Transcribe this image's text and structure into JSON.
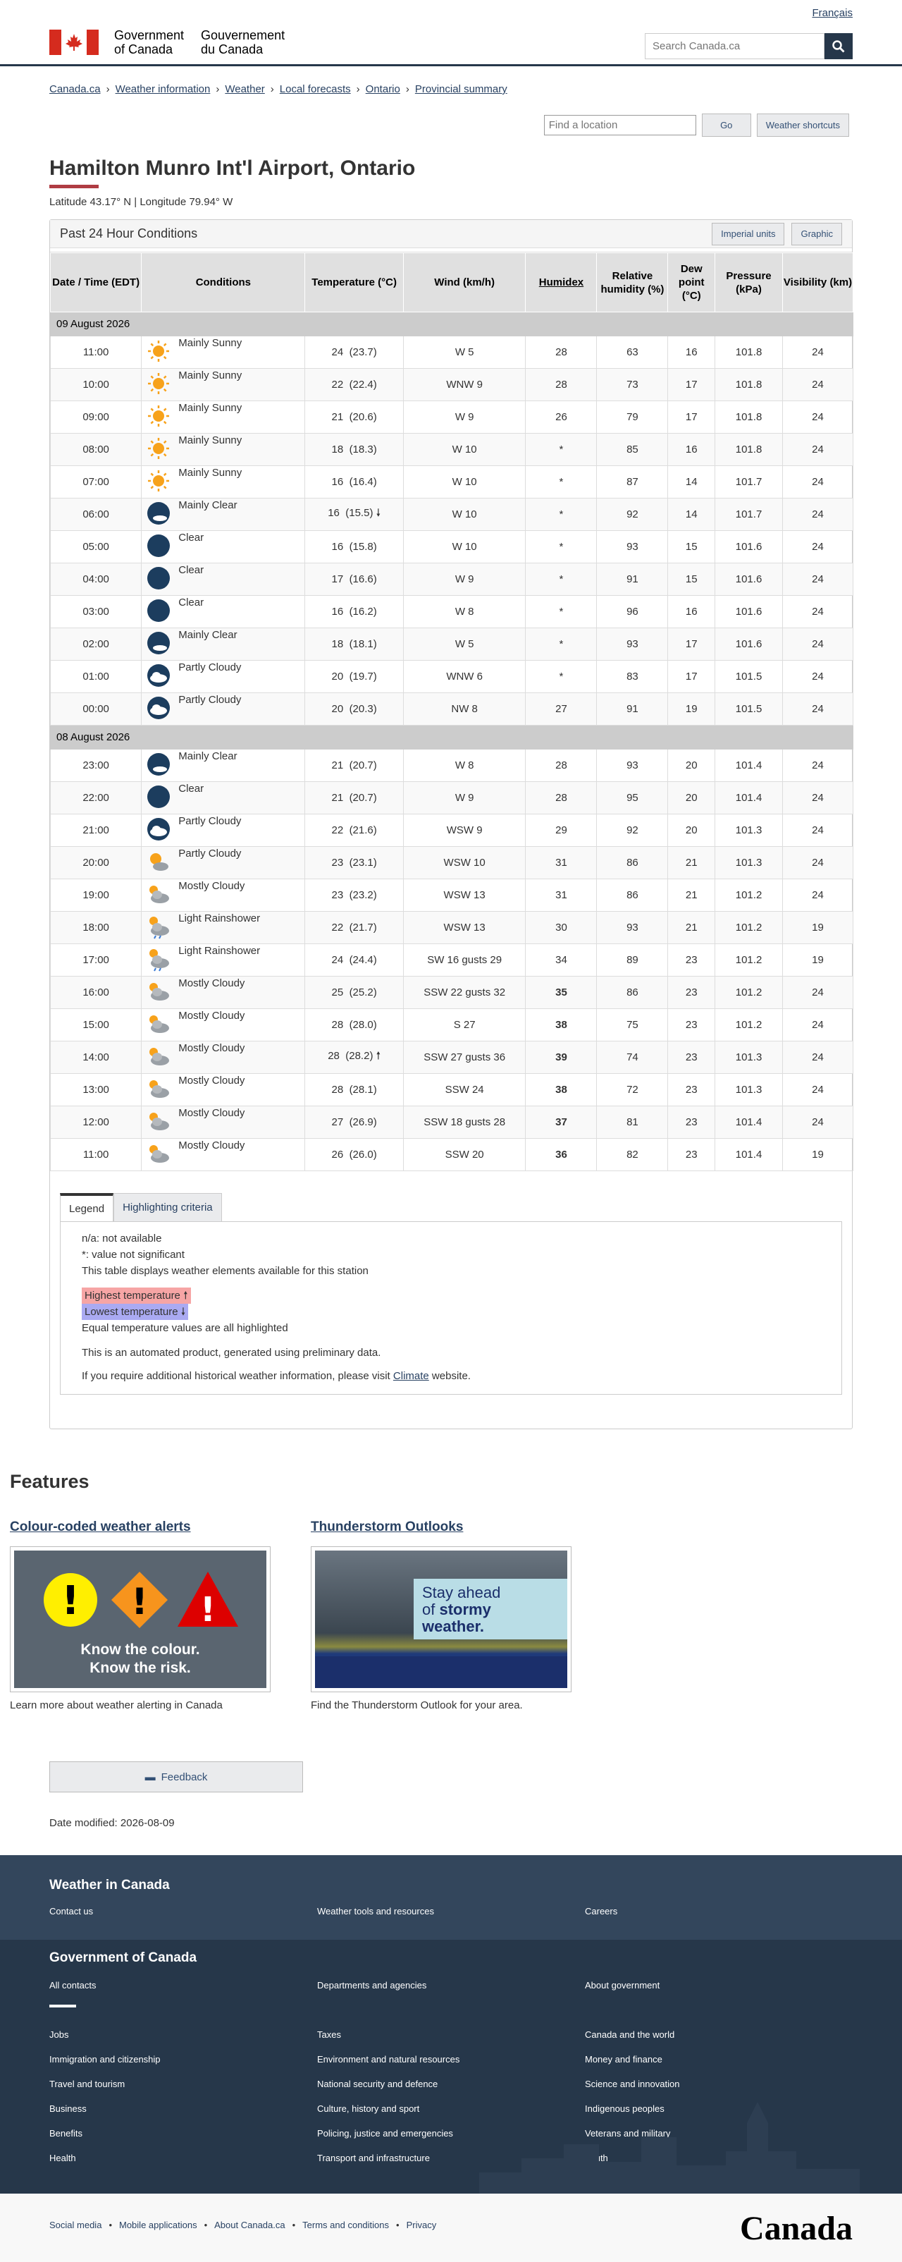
{
  "header": {
    "lang": "Français",
    "gov_en1": "Government",
    "gov_en2": "of Canada",
    "gov_fr1": "Gouvernement",
    "gov_fr2": "du Canada",
    "search_placeholder": "Search Canada.ca"
  },
  "breadcrumbs": [
    "Canada.ca",
    "Weather information",
    "Weather",
    "Local forecasts",
    "Ontario",
    "Provincial summary"
  ],
  "tools": {
    "find_placeholder": "Find a location",
    "go": "Go",
    "shortcuts": "Weather shortcuts"
  },
  "page": {
    "title": "Hamilton Munro Int'l Airport, Ontario",
    "coords": "Latitude 43.17° N | Longitude 79.94° W"
  },
  "panel": {
    "title": "Past 24 Hour Conditions",
    "imperial": "Imperial units",
    "graphic": "Graphic"
  },
  "table": {
    "headers": [
      "Date / Time (EDT)",
      "Conditions",
      "Temperature (°C)",
      "Wind (km/h)",
      "Humidex",
      "Relative humidity (%)",
      "Dew point (°C)",
      "Pressure (kPa)",
      "Visibility (km)"
    ],
    "days": [
      {
        "date": "09 August 2026",
        "rows": [
          [
            "11:00",
            "sun",
            "Mainly Sunny",
            "24",
            "(23.7)",
            "W 5",
            "28",
            "63",
            "16",
            "101.8",
            "24",
            ""
          ],
          [
            "10:00",
            "sun",
            "Mainly Sunny",
            "22",
            "(22.4)",
            "WNW 9",
            "28",
            "73",
            "17",
            "101.8",
            "24",
            ""
          ],
          [
            "09:00",
            "sun",
            "Mainly Sunny",
            "21",
            "(20.6)",
            "W 9",
            "26",
            "79",
            "17",
            "101.8",
            "24",
            ""
          ],
          [
            "08:00",
            "sun",
            "Mainly Sunny",
            "18",
            "(18.3)",
            "W 10",
            "*",
            "85",
            "16",
            "101.8",
            "24",
            ""
          ],
          [
            "07:00",
            "sun",
            "Mainly Sunny",
            "16",
            "(16.4)",
            "W 10",
            "*",
            "87",
            "14",
            "101.7",
            "24",
            ""
          ],
          [
            "06:00",
            "mclear",
            "Mainly Clear",
            "16",
            "(15.5)",
            "W 10",
            "*",
            "92",
            "14",
            "101.7",
            "24",
            "lo"
          ],
          [
            "05:00",
            "moon",
            "Clear",
            "16",
            "(15.8)",
            "W 10",
            "*",
            "93",
            "15",
            "101.6",
            "24",
            ""
          ],
          [
            "04:00",
            "moon",
            "Clear",
            "17",
            "(16.6)",
            "W 9",
            "*",
            "91",
            "15",
            "101.6",
            "24",
            ""
          ],
          [
            "03:00",
            "moon",
            "Clear",
            "16",
            "(16.2)",
            "W 8",
            "*",
            "96",
            "16",
            "101.6",
            "24",
            ""
          ],
          [
            "02:00",
            "mclear",
            "Mainly Clear",
            "18",
            "(18.1)",
            "W 5",
            "*",
            "93",
            "17",
            "101.6",
            "24",
            ""
          ],
          [
            "01:00",
            "pcloudn",
            "Partly Cloudy",
            "20",
            "(19.7)",
            "WNW 6",
            "*",
            "83",
            "17",
            "101.5",
            "24",
            ""
          ],
          [
            "00:00",
            "pcloudn",
            "Partly Cloudy",
            "20",
            "(20.3)",
            "NW 8",
            "27",
            "91",
            "19",
            "101.5",
            "24",
            ""
          ]
        ]
      },
      {
        "date": "08 August 2026",
        "rows": [
          [
            "23:00",
            "mclear",
            "Mainly Clear",
            "21",
            "(20.7)",
            "W 8",
            "28",
            "93",
            "20",
            "101.4",
            "24",
            ""
          ],
          [
            "22:00",
            "moon",
            "Clear",
            "21",
            "(20.7)",
            "W 9",
            "28",
            "95",
            "20",
            "101.4",
            "24",
            ""
          ],
          [
            "21:00",
            "pcloudn",
            "Partly Cloudy",
            "22",
            "(21.6)",
            "WSW 9",
            "29",
            "92",
            "20",
            "101.3",
            "24",
            ""
          ],
          [
            "20:00",
            "pcloud",
            "Partly Cloudy",
            "23",
            "(23.1)",
            "WSW 10",
            "31",
            "86",
            "21",
            "101.3",
            "24",
            ""
          ],
          [
            "19:00",
            "mcloud",
            "Mostly Cloudy",
            "23",
            "(23.2)",
            "WSW 13",
            "31",
            "86",
            "21",
            "101.2",
            "24",
            ""
          ],
          [
            "18:00",
            "rain",
            "Light Rainshower",
            "22",
            "(21.7)",
            "WSW 13",
            "30",
            "93",
            "21",
            "101.2",
            "19",
            ""
          ],
          [
            "17:00",
            "rain",
            "Light Rainshower",
            "24",
            "(24.4)",
            "SW 16 gusts 29",
            "34",
            "89",
            "23",
            "101.2",
            "19",
            ""
          ],
          [
            "16:00",
            "mcloud",
            "Mostly Cloudy",
            "25",
            "(25.2)",
            "SSW 22 gusts 32",
            "35",
            "86",
            "23",
            "101.2",
            "24",
            "",
            true
          ],
          [
            "15:00",
            "mcloud",
            "Mostly Cloudy",
            "28",
            "(28.0)",
            "S 27",
            "38",
            "75",
            "23",
            "101.2",
            "24",
            "",
            true
          ],
          [
            "14:00",
            "mcloud",
            "Mostly Cloudy",
            "28",
            "(28.2)",
            "SSW 27 gusts 36",
            "39",
            "74",
            "23",
            "101.3",
            "24",
            "hi",
            true
          ],
          [
            "13:00",
            "mcloud",
            "Mostly Cloudy",
            "28",
            "(28.1)",
            "SSW 24",
            "38",
            "72",
            "23",
            "101.3",
            "24",
            "",
            true
          ],
          [
            "12:00",
            "mcloud",
            "Mostly Cloudy",
            "27",
            "(26.9)",
            "SSW 18 gusts 28",
            "37",
            "81",
            "23",
            "101.4",
            "24",
            "",
            true
          ],
          [
            "11:00",
            "mcloud",
            "Mostly Cloudy",
            "26",
            "(26.0)",
            "SSW 20",
            "36",
            "82",
            "23",
            "101.4",
            "19",
            "",
            true
          ]
        ]
      }
    ]
  },
  "legend": {
    "tab1": "Legend",
    "tab2": "Highlighting criteria",
    "l1": "n/a: not available",
    "l2": "*: value not significant",
    "l3": "This table displays weather elements available for this station",
    "hi": "Highest temperature",
    "lo": "Lowest temperature",
    "eq": "Equal temperature values are all highlighted",
    "auto": "This is an automated product, generated using preliminary data.",
    "hist1": "If you require additional historical weather information, please visit ",
    "hist_link": "Climate",
    "hist2": " website."
  },
  "features": {
    "title": "Features",
    "f1_title": "Colour-coded weather alerts",
    "f1_img1": "Know the colour.",
    "f1_img2": "Know the risk.",
    "f1_cap": "Learn more about weather alerting in Canada",
    "f2_title": "Thunderstorm Outlooks",
    "f2_img1": "Stay ahead",
    "f2_img2": "of",
    "f2_img3": "stormy",
    "f2_img4": "weather.",
    "f2_cap": "Find the Thunderstorm Outlook for your area."
  },
  "feedback": "Feedback",
  "date_modified": "Date modified: 2026-08-09",
  "footer": {
    "wic": "Weather in Canada",
    "wic_links": [
      "Contact us",
      "Weather tools and resources",
      "Careers"
    ],
    "goc": "Government of Canada",
    "goc_top": [
      "All contacts",
      "Departments and agencies",
      "About government"
    ],
    "goc_links": [
      "Jobs",
      "Taxes",
      "Canada and the world",
      "Immigration and citizenship",
      "Environment and natural resources",
      "Money and finance",
      "Travel and tourism",
      "National security and defence",
      "Science and innovation",
      "Business",
      "Culture, history and sport",
      "Indigenous peoples",
      "Benefits",
      "Policing, justice and emergencies",
      "Veterans and military",
      "Health",
      "Transport and infrastructure",
      "Youth"
    ],
    "sub": [
      "Social media",
      "Mobile applications",
      "About Canada.ca",
      "Terms and conditions",
      "Privacy"
    ],
    "wordmark": "Canada"
  }
}
